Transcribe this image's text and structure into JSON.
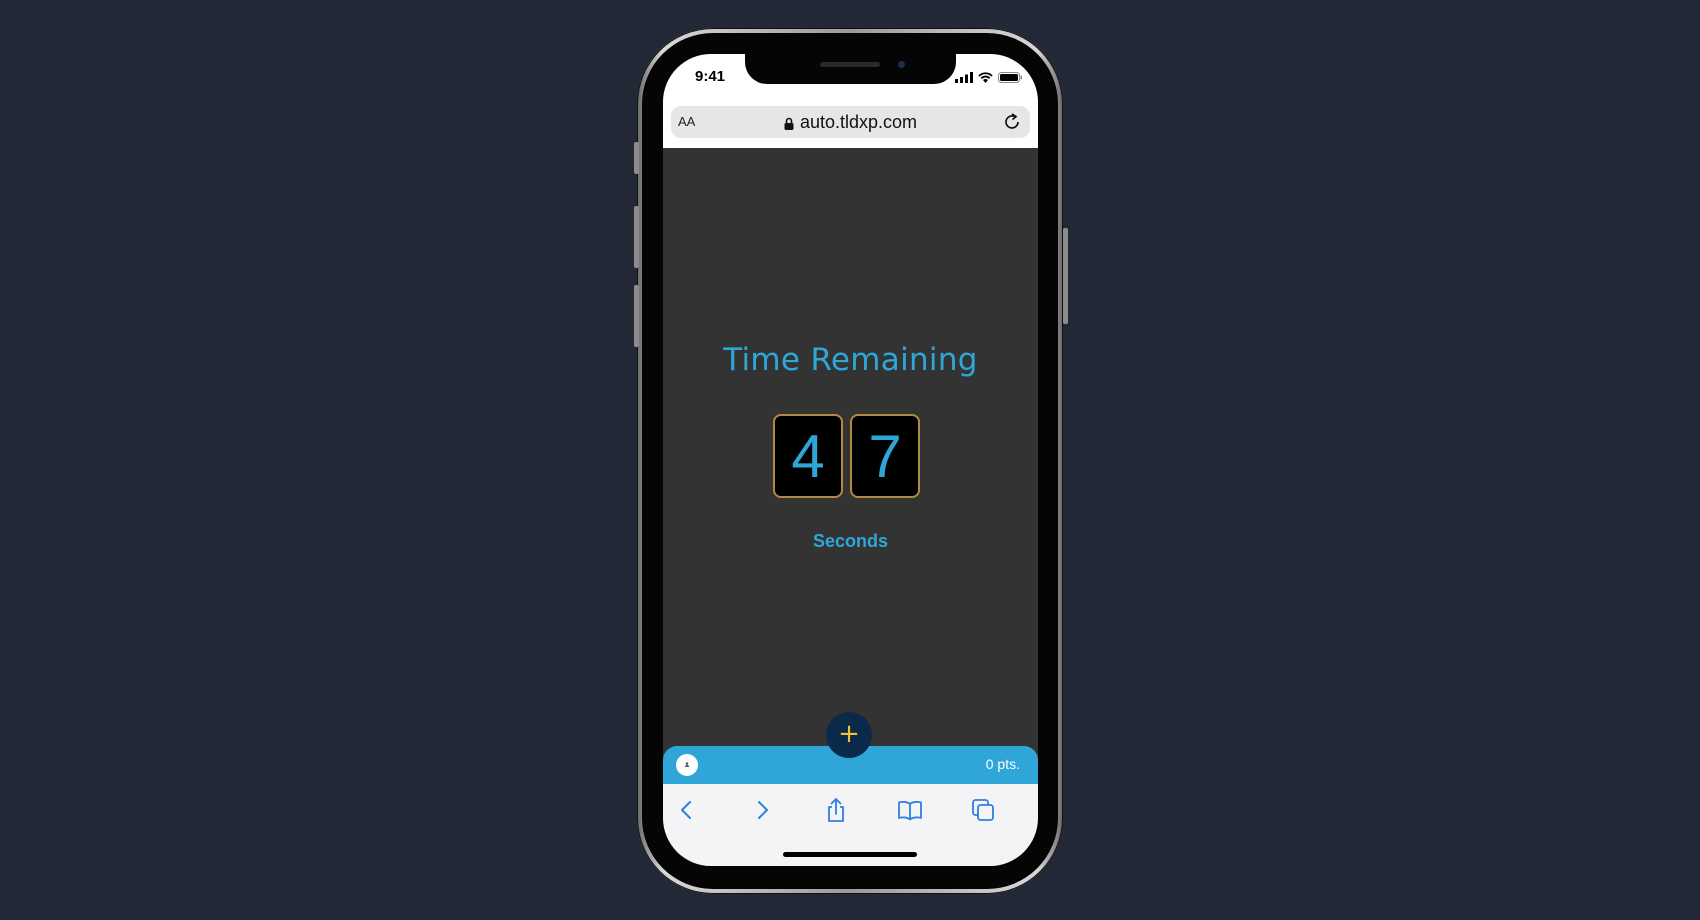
{
  "statusbar": {
    "time": "9:41"
  },
  "browser": {
    "text_size_label": "AA",
    "url": "auto.tldxp.com"
  },
  "timer": {
    "title": "Time Remaining",
    "digits": [
      "4",
      "7"
    ],
    "unit_label": "Seconds"
  },
  "points_bar": {
    "points_label": "0 pts."
  },
  "fab": {
    "label": "+"
  },
  "toolbar": {
    "items": [
      "back-icon",
      "forward-icon",
      "share-icon",
      "bookmarks-icon",
      "tabs-icon"
    ]
  },
  "colors": {
    "accent": "#2ea7d8",
    "digit_border": "#b08a40",
    "fab_bg": "#0b2a4a",
    "fab_plus": "#f2c233",
    "page_bg": "#222836",
    "screen_bg": "#333333"
  }
}
